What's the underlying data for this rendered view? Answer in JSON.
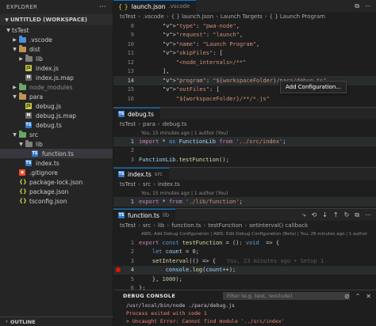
{
  "explorer": {
    "title": "EXPLORER",
    "more_icon": "ellipsis-icon",
    "workspace": "UNTITLED (WORKSPACE)",
    "items": [
      {
        "label": "tsTest",
        "type": "root-folder",
        "open": true
      },
      {
        "label": ".vscode",
        "type": "folder-blue",
        "open": false
      },
      {
        "label": "dist",
        "type": "folder",
        "open": true
      },
      {
        "label": "lib",
        "type": "folder-gray",
        "open": false
      },
      {
        "label": "index.js",
        "type": "js"
      },
      {
        "label": "index.js.map",
        "type": "map"
      },
      {
        "label": "node_modules",
        "type": "folder-green",
        "open": false
      },
      {
        "label": "para",
        "type": "folder",
        "open": true
      },
      {
        "label": "debug.js",
        "type": "js"
      },
      {
        "label": "debug.js.map",
        "type": "map"
      },
      {
        "label": "debug.ts",
        "type": "ts"
      },
      {
        "label": "src",
        "type": "folder-green",
        "open": true
      },
      {
        "label": "lib",
        "type": "folder-gray",
        "open": true
      },
      {
        "label": "function.ts",
        "type": "ts"
      },
      {
        "label": "index.ts",
        "type": "ts"
      },
      {
        "label": ".gitignore",
        "type": "git"
      },
      {
        "label": "package-lock.json",
        "type": "json"
      },
      {
        "label": "package.json",
        "type": "json"
      },
      {
        "label": "tsconfig.json",
        "type": "json"
      }
    ],
    "outline_label": "OUTLINE"
  },
  "launch_pane": {
    "tab": "launch.json",
    "tab_sub": ".vscode",
    "breadcrumb": [
      "tsTest",
      ".vscode",
      "{ } launch.json",
      "Launch Targets",
      "{ } Launch Program"
    ],
    "hover": "Add Configuration...",
    "lines": [
      {
        "num": "8",
        "text": "\"type\": \"pwa-node\","
      },
      {
        "num": "9",
        "text": "\"request\": \"launch\","
      },
      {
        "num": "10",
        "text": "\"name\": \"Launch Program\","
      },
      {
        "num": "11",
        "text": "\"skipFiles\": ["
      },
      {
        "num": "12",
        "text": "    \"<node_internals>/**\""
      },
      {
        "num": "13",
        "text": "],"
      },
      {
        "num": "14",
        "text": "\"program\": \"${workspaceFolder}/para/debug.ts\","
      },
      {
        "num": "15",
        "text": "\"outFiles\": ["
      },
      {
        "num": "16",
        "text": "    \"${workspaceFolder}/**/*.js\""
      }
    ]
  },
  "debug_pane": {
    "tab": "debug.ts",
    "breadcrumb": [
      "tsTest",
      "para",
      "debug.ts"
    ],
    "meta": "You, 15 minutes ago | 1 author (You)",
    "lines": [
      {
        "num": "1",
        "text": "import * as FunctionLib from '../src/index';"
      },
      {
        "num": "2",
        "text": ""
      },
      {
        "num": "3",
        "text": "FunctionLib.testFunction();"
      }
    ]
  },
  "index_pane": {
    "tab": "index.ts",
    "tab_sub": "src",
    "breadcrumb": [
      "tsTest",
      "src",
      "index.ts"
    ],
    "meta": "You, 15 minutes ago | 1 author (You)",
    "lines": [
      {
        "num": "1",
        "text": "export * from './lib/function';"
      }
    ]
  },
  "function_pane": {
    "tab": "function.ts",
    "tab_sub": "lib",
    "breadcrumb": [
      "tsTest",
      "src",
      "lib",
      "function.ts",
      "testFunction",
      "setInterval() callback"
    ],
    "meta": "AWS: Add Debug Configuration | AWS: Edit Debug Configuration (Beta) | You, 28 minutes ago | 1 author",
    "blame": "You, 23 minutes ago • Setup 1",
    "lines": [
      {
        "num": "1",
        "text": "export const testFunction = (): void  => {"
      },
      {
        "num": "2",
        "text": "    let count = 0;"
      },
      {
        "num": "3",
        "text": "    setInterval(() => {"
      },
      {
        "num": "4",
        "text": "        console.log(count++);"
      },
      {
        "num": "5",
        "text": "    }, 1000);"
      },
      {
        "num": "6",
        "text": "};"
      }
    ]
  },
  "debug_console": {
    "title": "DEBUG CONSOLE",
    "filter_placeholder": "Filter (e.g. text, !exclude)",
    "lines": [
      "/usr/local/bin/node ./para/debug.js",
      "Process exited with code 1",
      "> Uncaught Error: Cannot find module '../src/index'"
    ]
  },
  "colors": {
    "accent": "#0078d4",
    "error": "#f48771",
    "breakpoint": "#e51400"
  }
}
